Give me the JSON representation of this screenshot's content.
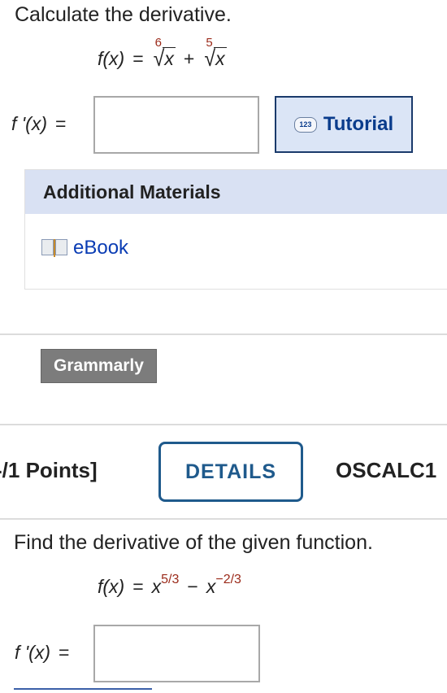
{
  "question1": {
    "prompt": "Calculate the derivative.",
    "function_lhs": "f(x)",
    "equals": "=",
    "term1_index": "6",
    "term1_radicand": "x",
    "plus": "+",
    "term2_index": "5",
    "term2_radicand": "x",
    "answer_label": "f '(x)",
    "answer_equals": "=",
    "answer_value": "",
    "tutorial_icon_text": "123",
    "tutorial_label": "Tutorial"
  },
  "additional_materials": {
    "title": "Additional Materials",
    "ebook_label": "eBook"
  },
  "grammarly_label": "Grammarly",
  "question2_header": {
    "points": "-/1 Points]",
    "details_label": "DETAILS",
    "course_code": "OSCALC1"
  },
  "question2": {
    "prompt": "Find the derivative of the given function.",
    "function_lhs": "f(x)",
    "equals": "=",
    "base1": "x",
    "exp1": "5/3",
    "minus": "−",
    "base2": "x",
    "exp2": "−2/3",
    "answer_label": "f '(x)",
    "answer_equals": "=",
    "answer_value": ""
  },
  "colors": {
    "link": "#0a3cb4",
    "tutorial_bg": "#dbe5f6",
    "panel_header_bg": "#d9e1f3",
    "details_border": "#1f5a8c",
    "exponent": "#9b2a1a"
  }
}
